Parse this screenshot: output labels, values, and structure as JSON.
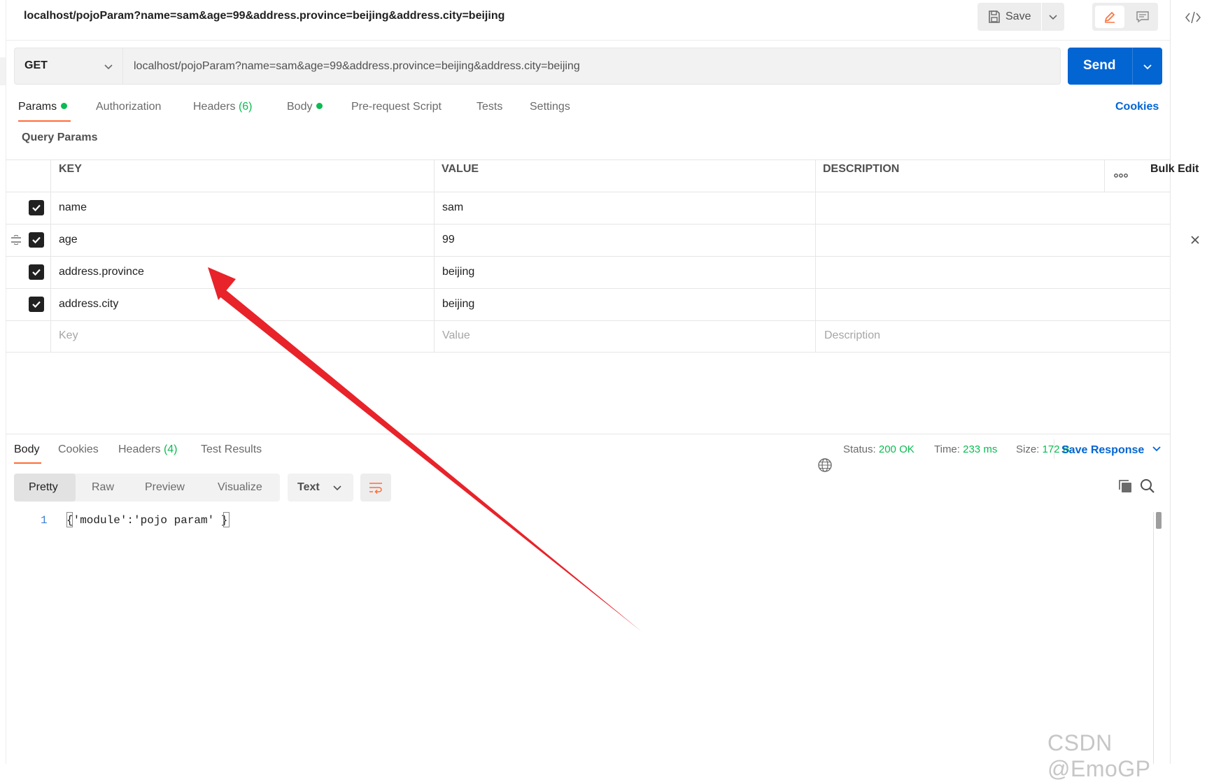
{
  "window": {
    "title": "localhost/pojoParam?name=sam&age=99&address.province=beijing&address.city=beijing",
    "save_label": "Save"
  },
  "request": {
    "method": "GET",
    "url": "localhost/pojoParam?name=sam&age=99&address.province=beijing&address.city=beijing",
    "send_label": "Send",
    "tabs": [
      {
        "label": "Params",
        "dot": true,
        "active": true
      },
      {
        "label": "Authorization"
      },
      {
        "label": "Headers",
        "count": "(6)"
      },
      {
        "label": "Body",
        "dot": true
      },
      {
        "label": "Pre-request Script"
      },
      {
        "label": "Tests"
      },
      {
        "label": "Settings"
      }
    ],
    "cookies_label": "Cookies"
  },
  "params": {
    "title": "Query Params",
    "columns": {
      "key": "KEY",
      "value": "VALUE",
      "description": "DESCRIPTION",
      "bulk_edit": "Bulk Edit"
    },
    "rows": [
      {
        "key": "name",
        "value": "sam",
        "checked": true
      },
      {
        "key": "age",
        "value": "99",
        "checked": true
      },
      {
        "key": "address.province",
        "value": "beijing",
        "checked": true
      },
      {
        "key": "address.city",
        "value": "beijing",
        "checked": true
      }
    ],
    "placeholders": {
      "key": "Key",
      "value": "Value",
      "description": "Description"
    }
  },
  "response": {
    "tabs": [
      {
        "label": "Body",
        "active": true
      },
      {
        "label": "Cookies"
      },
      {
        "label": "Headers",
        "count": "(4)"
      },
      {
        "label": "Test Results"
      }
    ],
    "status_label": "Status:",
    "status_value": "200 OK",
    "time_label": "Time:",
    "time_value": "233 ms",
    "size_label": "Size:",
    "size_value": "172 B",
    "save_response_label": "Save Response",
    "view_options": [
      "Pretty",
      "Raw",
      "Preview",
      "Visualize"
    ],
    "format": "Text",
    "body_lines": [
      {
        "number": "1",
        "text": "{'module':'pojo param' }"
      }
    ]
  },
  "watermark": "CSDN @EmoGP",
  "colors": {
    "accent": "#ff6c37",
    "primary": "#0265d2",
    "success": "#0cbb52",
    "annotation_arrow": "#e8232a"
  }
}
